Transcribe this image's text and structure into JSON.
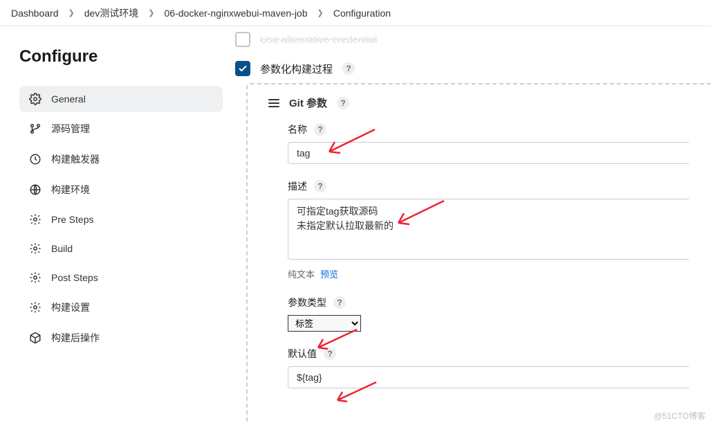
{
  "breadcrumb": {
    "dashboard": "Dashboard",
    "env": "dev测试环境",
    "job": "06-docker-nginxwebui-maven-job",
    "config": "Configuration"
  },
  "page_title": "Configure",
  "sidebar": {
    "items": [
      {
        "label": "General"
      },
      {
        "label": "源码管理"
      },
      {
        "label": "构建触发器"
      },
      {
        "label": "构建环境"
      },
      {
        "label": "Pre Steps"
      },
      {
        "label": "Build"
      },
      {
        "label": "Post Steps"
      },
      {
        "label": "构建设置"
      },
      {
        "label": "构建后操作"
      }
    ]
  },
  "form": {
    "parametrized_label": "参数化构建过程",
    "git_param_title": "Git 参数",
    "name_label": "名称",
    "name_value": "tag",
    "desc_label": "描述",
    "desc_value": "可指定tag获取源码\n未指定默认拉取最新的",
    "plain_text": "纯文本",
    "preview": "预览",
    "param_type_label": "参数类型",
    "param_type_value": "标签",
    "default_label": "默认值",
    "default_value": "${tag}"
  },
  "watermark": "@51CTO博客"
}
